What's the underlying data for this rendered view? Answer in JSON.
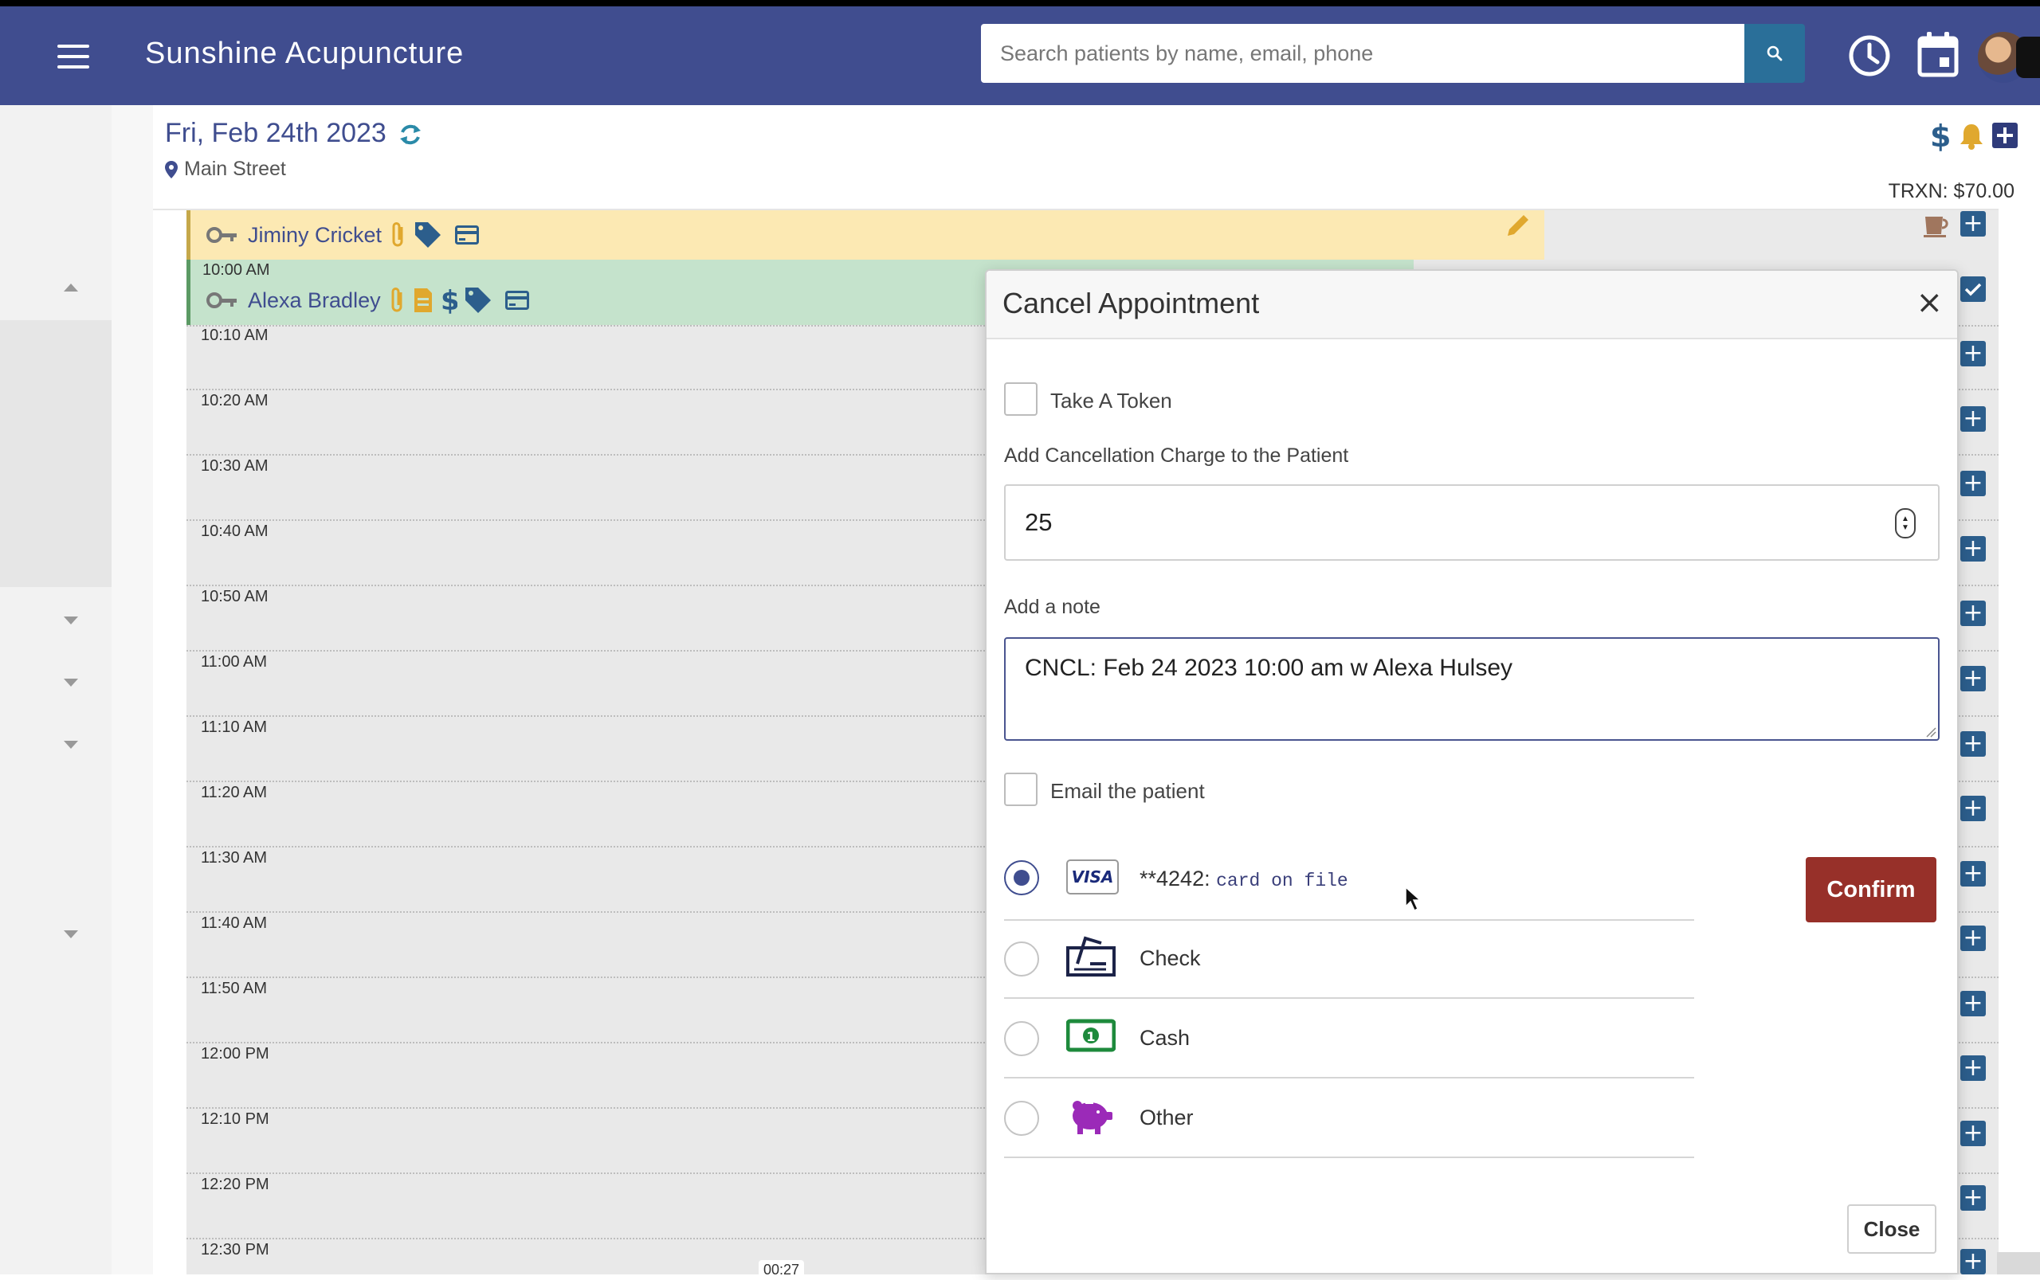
{
  "topbar": {
    "brand": "Sunshine Acupuncture",
    "search_placeholder": "Search patients by name, email, phone",
    "search_value": ""
  },
  "header": {
    "date": "Fri, Feb 24th 2023",
    "location": "Main Street",
    "trxn": "TRXN: $70.00"
  },
  "appointments": [
    {
      "name": "Jiminy Cricket",
      "time": ""
    },
    {
      "name": "Alexa Bradley",
      "time": "10:00 AM"
    }
  ],
  "time_slots": [
    "10:10 AM",
    "10:20 AM",
    "10:30 AM",
    "10:40 AM",
    "10:50 AM",
    "11:00 AM",
    "11:10 AM",
    "11:20 AM",
    "11:30 AM",
    "11:40 AM",
    "11:50 AM",
    "12:00 PM",
    "12:10 PM",
    "12:20 PM",
    "12:30 PM"
  ],
  "video_time": "00:27",
  "modal": {
    "title": "Cancel Appointment",
    "close_x": "×",
    "take_token_label": "Take A Token",
    "take_token_checked": false,
    "charge_label": "Add Cancellation Charge to the Patient",
    "charge_value": "25",
    "note_label": "Add a note",
    "note_value": "CNCL: Feb 24 2023 10:00 am w Alexa Hulsey",
    "email_label": "Email the patient",
    "email_checked": false,
    "payment_options": [
      {
        "icon": "visa-card-icon",
        "label": "**4242:",
        "sub": "card on file",
        "selected": true
      },
      {
        "icon": "check-icon",
        "label": "Check",
        "sub": "",
        "selected": false
      },
      {
        "icon": "cash-icon",
        "label": "Cash",
        "sub": "",
        "selected": false
      },
      {
        "icon": "piggy-bank-icon",
        "label": "Other",
        "sub": "",
        "selected": false
      }
    ],
    "confirm_label": "Confirm",
    "close_label": "Close"
  },
  "colors": {
    "topbar": "#404d8f",
    "accent": "#3f4d8f",
    "confirm": "#973029",
    "appointment_yellow": "#fce9b3",
    "appointment_green": "#c5e3cc",
    "tag_teal": "#2c5e8c",
    "attach_gold": "#e0a82e",
    "cash_green": "#1e8a3c",
    "piggy_purple": "#9b2ab8"
  }
}
